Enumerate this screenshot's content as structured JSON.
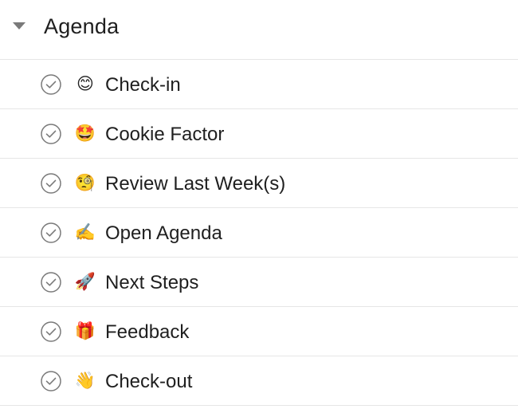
{
  "section": {
    "title": "Agenda",
    "toggle_icon": "caret-down-icon",
    "expanded": true
  },
  "tasks": [
    {
      "label": "Check-in",
      "emoji": "😊",
      "icon": "smiling-face-icon",
      "completed": false
    },
    {
      "label": "Cookie Factor",
      "emoji": "🤩",
      "icon": "star-struck-face-icon",
      "completed": false
    },
    {
      "label": "Review Last Week(s)",
      "emoji": "🧐",
      "icon": "monocle-face-icon",
      "completed": false
    },
    {
      "label": "Open Agenda",
      "emoji": "✍️",
      "icon": "writing-hand-icon",
      "completed": false
    },
    {
      "label": "Next Steps",
      "emoji": "🚀",
      "icon": "rocket-icon",
      "completed": false
    },
    {
      "label": "Feedback",
      "emoji": "🎁",
      "icon": "gift-icon",
      "completed": false
    },
    {
      "label": "Check-out",
      "emoji": "👋",
      "icon": "waving-hand-icon",
      "completed": false
    }
  ],
  "colors": {
    "text": "#1f1f1f",
    "checkbox_stroke": "#7a7a7a",
    "divider": "#e6e6e6",
    "caret": "#7a7a7a"
  }
}
